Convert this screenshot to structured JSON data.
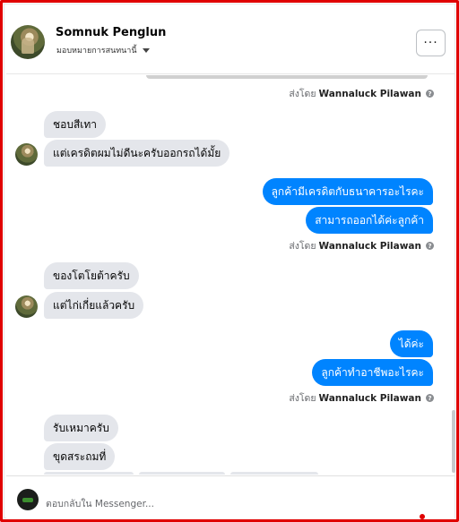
{
  "header": {
    "name": "Somnuk Penglun",
    "subtitle": "มอบหมายการสนทนานี้",
    "more_label": "···"
  },
  "thread": {
    "sent_by_prefix": "ส่งโดย",
    "sent_by_name": "Wannaluck Pilawan",
    "info_icon": "?",
    "messages": [
      {
        "text": "ชอบสีเทา"
      },
      {
        "text": "แต่เครดิตผมไม่ดีนะครับออกรถได้มั้ย"
      },
      {
        "text": "ลูกค้ามีเครดิตกับธนาคารอะไรคะ"
      },
      {
        "text": "สามารถออกได้ค่ะลูกค้า"
      },
      {
        "text": "ของโตโยต้าครับ"
      },
      {
        "text": "แต่ไก่เกี่ยแล้วครับ"
      },
      {
        "text": "ได้ค่ะ"
      },
      {
        "text": "ลูกค้าทำอาชีพอะไรคะ"
      },
      {
        "text": "รับเหมาครับ"
      },
      {
        "text": "ขุดสระถมที่"
      }
    ]
  },
  "composer": {
    "placeholder": "ตอบกลับใน Messenger..."
  },
  "colors": {
    "frame": "#e00000",
    "outgoing_bubble": "#0084ff",
    "incoming_bubble": "#e4e6eb"
  },
  "icons": {
    "more": "more-icon",
    "dropdown": "caret-down-icon",
    "info": "info-icon"
  }
}
